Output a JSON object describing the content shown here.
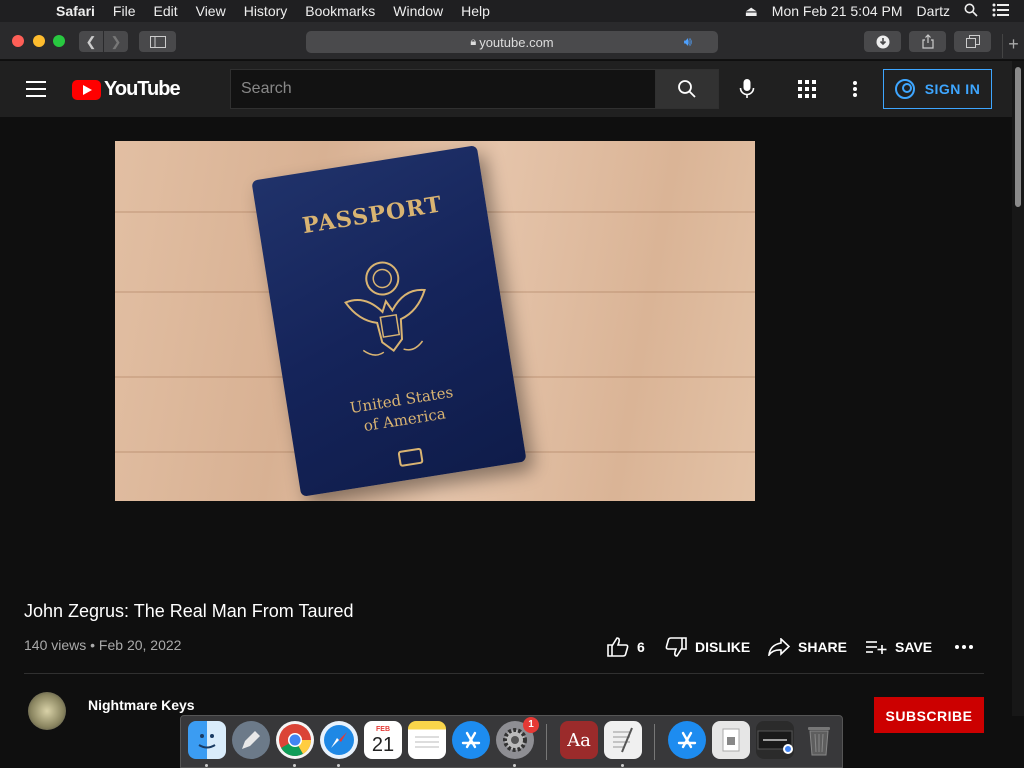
{
  "menubar": {
    "app": "Safari",
    "items": [
      "File",
      "Edit",
      "View",
      "History",
      "Bookmarks",
      "Window",
      "Help"
    ],
    "datetime": "Mon Feb 21  5:04 PM",
    "user": "Dartz"
  },
  "browser": {
    "url": "youtube.com"
  },
  "youtube": {
    "logo_text": "YouTube",
    "search_placeholder": "Search",
    "signin_label": "SIGN IN"
  },
  "video": {
    "thumbnail": {
      "passport_title": "PASSPORT",
      "country_line1": "United States",
      "country_line2": "of America"
    },
    "title": "John Zegrus: The Real Man From Taured",
    "meta": "140 views • Feb 20, 2022",
    "likes": "6",
    "dislike_label": "DISLIKE",
    "share_label": "SHARE",
    "save_label": "SAVE",
    "channel_name": "Nightmare Keys",
    "subscribe_label": "SUBSCRIBE"
  },
  "dock": {
    "calendar_day": "21",
    "calendar_month": "FEB",
    "badge": "1",
    "dictionary_label": "Aa"
  },
  "colors": {
    "youtube_red": "#ff0000",
    "signin_blue": "#3ea6ff",
    "subscribe_red": "#cc0000"
  }
}
